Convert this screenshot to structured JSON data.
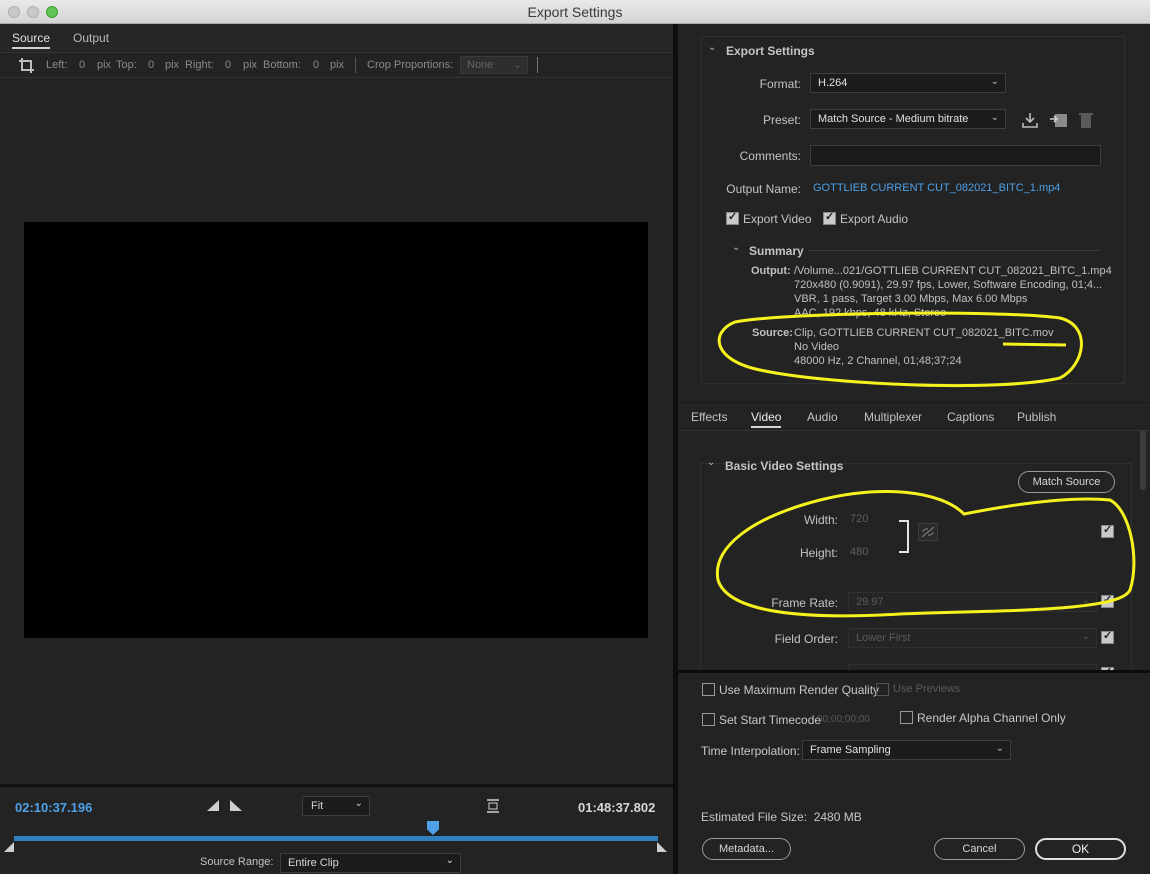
{
  "window": {
    "title": "Export Settings"
  },
  "left": {
    "tabs": [
      "Source",
      "Output"
    ],
    "crop": {
      "left_label": "Left:",
      "left_val": "0",
      "pix1": "pix",
      "top_label": "Top:",
      "top_val": "0",
      "pix2": "pix",
      "right_label": "Right:",
      "right_val": "0",
      "pix3": "pix",
      "bottom_label": "Bottom:",
      "bottom_val": "0",
      "pix4": "pix",
      "proportions_label": "Crop Proportions:",
      "proportions_val": "None"
    },
    "timecode_current": "02:10:37.196",
    "timecode_duration": "01:48:37.802",
    "fit": "Fit",
    "source_range_label": "Source Range:",
    "source_range": "Entire Clip"
  },
  "export": {
    "header": "Export Settings",
    "format_label": "Format:",
    "format": "H.264",
    "preset_label": "Preset:",
    "preset": "Match Source - Medium bitrate",
    "comments_label": "Comments:",
    "comments": "",
    "output_name_label": "Output Name:",
    "output_name": "GOTTLIEB CURRENT CUT_082021_BITC_1.mp4",
    "export_video": "Export Video",
    "export_audio": "Export Audio",
    "summary_header": "Summary",
    "output_label": "Output:",
    "output_lines": "/Volume...021/GOTTLIEB CURRENT CUT_082021_BITC_1.mp4\n720x480 (0.9091), 29.97 fps, Lower, Software Encoding, 01;4...\nVBR, 1 pass, Target 3.00 Mbps, Max 6.00 Mbps\nAAC, 192 kbps, 48 kHz, Stereo",
    "source_label": "Source:",
    "source_lines": "Clip, GOTTLIEB CURRENT CUT_082021_BITC.mov\nNo Video\n48000 Hz, 2 Channel, 01;48;37;24"
  },
  "tabs_right": [
    "Effects",
    "Video",
    "Audio",
    "Multiplexer",
    "Captions",
    "Publish"
  ],
  "video": {
    "header": "Basic Video Settings",
    "match_source": "Match Source",
    "width_label": "Width:",
    "width": "720",
    "height_label": "Height:",
    "height": "480",
    "frame_rate_label": "Frame Rate:",
    "frame_rate": "29.97",
    "field_order_label": "Field Order:",
    "field_order": "Lower First"
  },
  "render": {
    "max_quality": "Use Maximum Render Quality",
    "use_previews": "Use Previews",
    "set_start_tc": "Set Start Timecode",
    "start_tc": "00;00;00;00",
    "alpha_only": "Render Alpha Channel Only",
    "interp_label": "Time Interpolation:",
    "interp": "Frame Sampling",
    "est_size": "Estimated File Size:  2480 MB",
    "metadata": "Metadata...",
    "cancel": "Cancel",
    "ok": "OK"
  },
  "colors": {
    "accent_blue": "#4ea0e8",
    "annotation_yellow": "#f5f21e"
  }
}
